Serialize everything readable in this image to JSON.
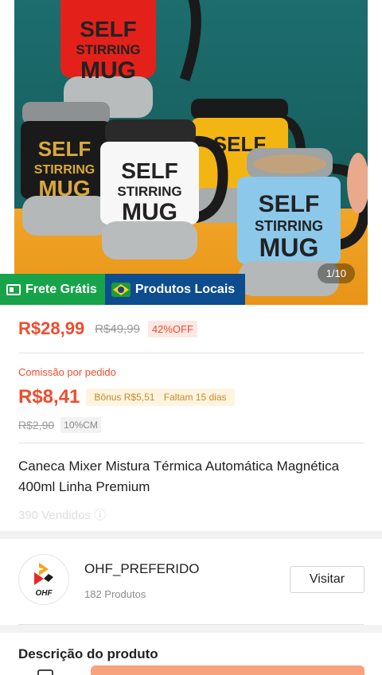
{
  "product_image": {
    "mug_text_line1": "SELF",
    "mug_text_line2": "STIRRING",
    "mug_text_line3": "MUG",
    "counter": "1/10",
    "colors": {
      "background": "#1b6868",
      "table": "#f0a225",
      "red_mug": "#e3211a",
      "black_mug": "#1a1a1a",
      "white_mug": "#f7f7f7",
      "yellow_mug": "#f3b512",
      "blue_mug": "#8cc8ea",
      "mug_text_dark": "#222222",
      "mug_text_light": "#d9a93d"
    }
  },
  "badges": {
    "shipping": {
      "label": "Frete Grátis",
      "icon": "free-shipping-icon",
      "color": "#17a34a"
    },
    "local": {
      "label": "Produtos Locais",
      "icon": "brazil-flag-icon",
      "color": "#0d4d8f"
    }
  },
  "price": {
    "current": "R$28,99",
    "original": "R$49,99",
    "discount": "42%OFF"
  },
  "commission": {
    "label": "Comissão por pedido",
    "value": "R$8,41",
    "bonus": "Bônus R$5,51",
    "days_left": "Faltam 15 dias",
    "old_value": "R$2,90",
    "cm_rate": "10%CM"
  },
  "product": {
    "title": "Caneca Mixer Mistura Térmica Automática Magnética 400ml Linha Premium",
    "sold": "390 Vendidos ⓘ"
  },
  "shop": {
    "name": "OHF_PREFERIDO",
    "products": "182 Produtos",
    "visit_label": "Visitar",
    "logo_text": "OHF"
  },
  "description": {
    "title": "Descrição do produto"
  },
  "theme": {
    "accent": "#ee4d2d",
    "buy_button": "#f8a37e"
  }
}
